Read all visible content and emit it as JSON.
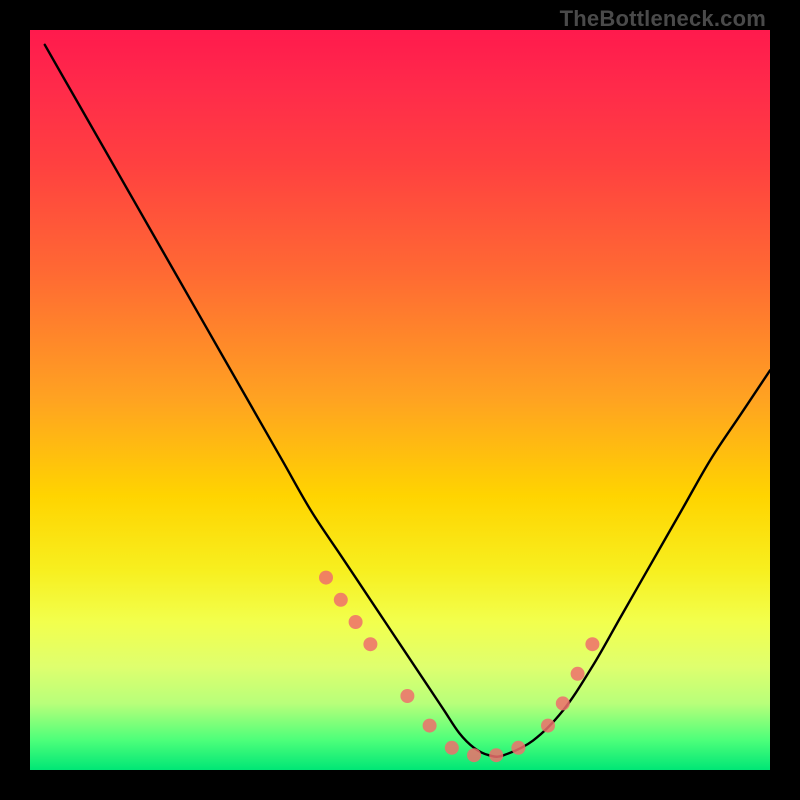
{
  "watermark": "TheBottleneck.com",
  "colors": {
    "background": "#000000",
    "gradient_top": "#ff1a4d",
    "gradient_mid": "#ffd400",
    "gradient_bottom": "#00e676",
    "curve": "#000000",
    "markers": "#ef6f6c"
  },
  "chart_data": {
    "type": "line",
    "title": "",
    "xlabel": "",
    "ylabel": "",
    "xlim": [
      0,
      100
    ],
    "ylim": [
      0,
      100
    ],
    "series": [
      {
        "name": "bottleneck-curve",
        "x": [
          2,
          6,
          10,
          14,
          18,
          22,
          26,
          30,
          34,
          38,
          42,
          46,
          50,
          54,
          56,
          58,
          60,
          62,
          64,
          68,
          72,
          76,
          80,
          84,
          88,
          92,
          96,
          100
        ],
        "y": [
          98,
          91,
          84,
          77,
          70,
          63,
          56,
          49,
          42,
          35,
          29,
          23,
          17,
          11,
          8,
          5,
          3,
          2,
          2,
          4,
          8,
          14,
          21,
          28,
          35,
          42,
          48,
          54
        ]
      },
      {
        "name": "markers",
        "x": [
          40,
          42,
          44,
          46,
          51,
          54,
          57,
          60,
          63,
          66,
          70,
          72,
          74,
          76
        ],
        "y": [
          26,
          23,
          20,
          17,
          10,
          6,
          3,
          2,
          2,
          3,
          6,
          9,
          13,
          17
        ]
      }
    ]
  }
}
